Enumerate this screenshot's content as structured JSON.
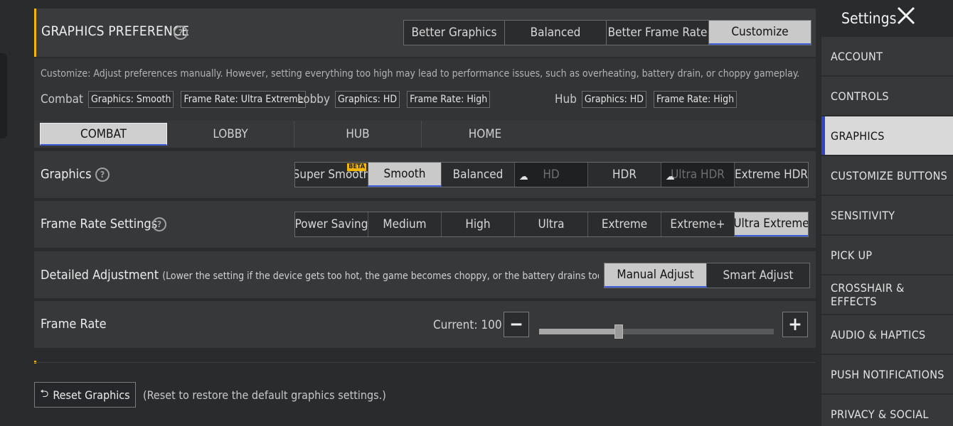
{
  "header": {
    "title": "GRAPHICS PREFERENCE",
    "presets": [
      "Better Graphics",
      "Balanced",
      "Better Frame Rate",
      "Customize"
    ],
    "active_preset": "Customize"
  },
  "description": "Customize: Adjust preferences manually. However, setting everything too high may lead to performance issues, such as overheating, battery drain, or choppy gameplay.",
  "summary": {
    "combat_label": "Combat",
    "combat_graphics": "Graphics: Smooth",
    "combat_frame": "Frame Rate: Ultra Extreme",
    "lobby_label": "Lobby",
    "lobby_graphics": "Graphics: HD",
    "lobby_frame": "Frame Rate: High",
    "hub_label": "Hub",
    "hub_graphics": "Graphics: HD",
    "hub_frame": "Frame Rate: High"
  },
  "tabs": [
    "COMBAT",
    "LOBBY",
    "HUB",
    "HOME"
  ],
  "graphics": {
    "label": "Graphics",
    "options": [
      "Super Smooth",
      "Smooth",
      "Balanced",
      "HD",
      "HDR",
      "Ultra HDR",
      "Extreme HDR"
    ],
    "beta_badge": "BETA",
    "selected": "Smooth"
  },
  "frame_rate_settings": {
    "label": "Frame Rate Settings",
    "options": [
      "Power Saving",
      "Medium",
      "High",
      "Ultra",
      "Extreme",
      "Extreme+",
      "Ultra Extreme"
    ],
    "selected": "Ultra Extreme"
  },
  "detailed": {
    "label": "Detailed Adjustment",
    "sublabel": "(Lower the setting if the device gets too hot, the game becomes choppy, or the battery drains too quickly)",
    "options": [
      "Manual Adjust",
      "Smart Adjust"
    ],
    "selected": "Manual Adjust"
  },
  "frame_rate": {
    "label": "Frame Rate",
    "current_text": "Current: 100",
    "level": 0.34
  },
  "reset": {
    "label": "Reset Graphics",
    "note": "(Reset to restore the default graphics settings.)"
  },
  "sidebar": {
    "title": "Settings",
    "items": [
      "ACCOUNT",
      "CONTROLS",
      "GRAPHICS",
      "CUSTOMIZE BUTTONS",
      "SENSITIVITY",
      "PICK UP",
      "CROSSHAIR & EFFECTS",
      "AUDIO & HAPTICS",
      "PUSH NOTIFICATIONS",
      "PRIVACY & SOCIAL"
    ],
    "active": "GRAPHICS"
  },
  "colors": {
    "accent_yellow": "#f2b705",
    "accent_blue": "#3c5bd8",
    "selected_bg": "#c9c9c9"
  },
  "icons": {
    "help": "question-circle-icon",
    "cloud": "cloud-download-icon",
    "close": "close-icon",
    "reset": "undo-arrow-icon",
    "minus": "minus-icon",
    "plus": "plus-icon"
  }
}
